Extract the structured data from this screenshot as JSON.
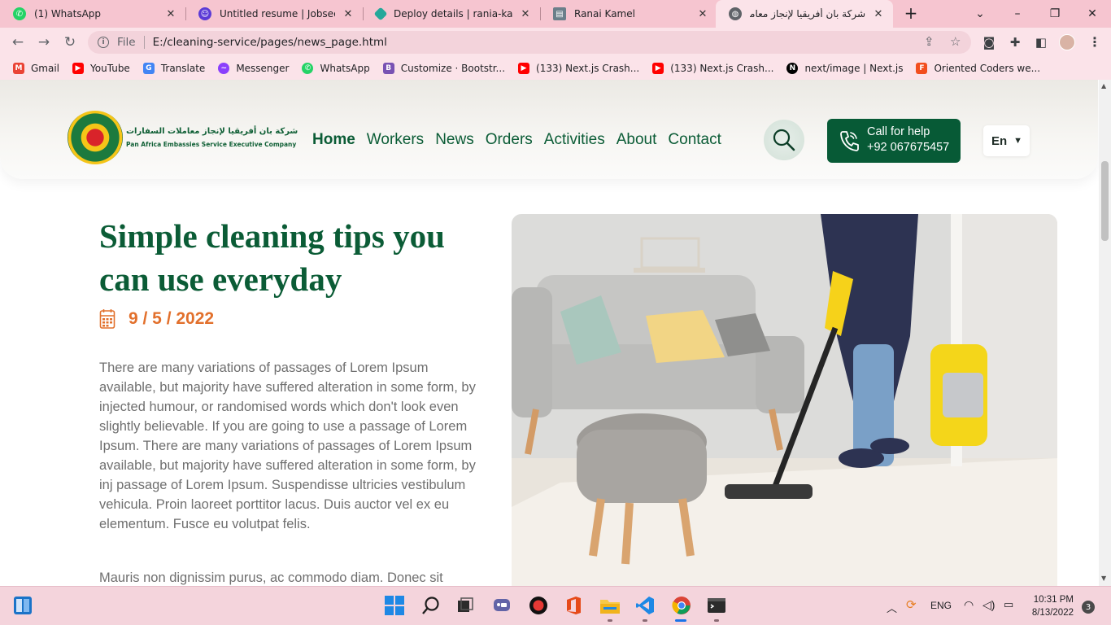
{
  "browser": {
    "tabs": [
      {
        "title": "(1) WhatsApp",
        "icon": "whatsapp-icon",
        "color": "#25d366"
      },
      {
        "title": "Untitled resume | Jobseeker",
        "icon": "jobseeker-icon",
        "color": "#5b3bd6"
      },
      {
        "title": "Deploy details | rania-kamel-",
        "icon": "netlify-icon",
        "color": "#24a89a"
      },
      {
        "title": "Ranai Kamel",
        "icon": "portfolio-icon",
        "color": "#6b7f8a"
      },
      {
        "title": "شركة بان أفريقيا لإنجاز معاملات",
        "icon": "globe-icon",
        "color": "#5f6368",
        "active": true
      }
    ],
    "new_tab": "+",
    "window_controls": {
      "minimize": "–",
      "maximize": "❐",
      "close": "✕",
      "tab_search": "⌄"
    },
    "address": {
      "scheme": "File",
      "url": "E:/cleaning-service/pages/news_page.html"
    },
    "bookmarks": [
      {
        "label": "Gmail",
        "icon": "gmail-icon",
        "color": "#ea4335"
      },
      {
        "label": "YouTube",
        "icon": "youtube-icon",
        "color": "#ff0000"
      },
      {
        "label": "Translate",
        "icon": "translate-icon",
        "color": "#4285f4"
      },
      {
        "label": "Messenger",
        "icon": "messenger-icon",
        "color": "#8a3ffc"
      },
      {
        "label": "WhatsApp",
        "icon": "whatsapp-icon",
        "color": "#25d366"
      },
      {
        "label": "Customize · Bootstr...",
        "icon": "bootstrap-icon",
        "color": "#7952b3"
      },
      {
        "label": "(133) Next.js Crash...",
        "icon": "youtube-icon",
        "color": "#ff0000"
      },
      {
        "label": "(133) Next.js Crash...",
        "icon": "youtube-icon",
        "color": "#ff0000"
      },
      {
        "label": "next/image | Next.js",
        "icon": "nextjs-icon",
        "color": "#000000"
      },
      {
        "label": "Oriented Coders we...",
        "icon": "figma-icon",
        "color": "#f24e1e"
      }
    ]
  },
  "site": {
    "logo": {
      "arabic": "شركة بان أفريقيا لإنجاز معاملات السفارات",
      "english": "Pan Africa Embassies Service Executive Company"
    },
    "nav": [
      "Home",
      "Workers",
      "News",
      "Orders",
      "Activities",
      "About",
      "Contact"
    ],
    "call": {
      "line1": "Call for help",
      "line2": "+92 067675457"
    },
    "language": "En",
    "colors": {
      "brand_green": "#075a36",
      "accent_orange": "#e2702c"
    }
  },
  "article": {
    "title": "Simple cleaning tips you can use everyday",
    "date": "9 / 5 / 2022",
    "paragraphs": [
      "There are many variations of passages of Lorem Ipsum available, but majority have suffered alteration in some form, by injected humour, or randomised words which don't look even slightly believable. If you are going to use a passage of Lorem Ipsum. There are many variations of passages of Lorem Ipsum available, but majority have suffered alteration in some form, by inj passage of Lorem Ipsum. Suspendisse ultricies vestibulum vehicula. Proin laoreet porttitor lacus. Duis auctor vel ex eu elementum. Fusce eu volutpat felis.",
      "Mauris non dignissim purus, ac commodo diam. Donec sit"
    ]
  },
  "taskbar": {
    "lang": "ENG",
    "time": "10:31 PM",
    "date": "8/13/2022",
    "notifications": "3"
  }
}
